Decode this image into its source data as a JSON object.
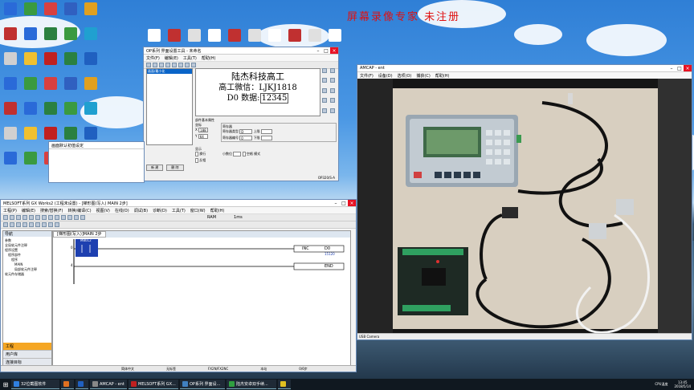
{
  "watermark": "屏幕录像专家 未注册",
  "desktop_icons": [
    {
      "label": "",
      "color": "#2a6ad8"
    },
    {
      "label": "",
      "color": "#3a9a40"
    },
    {
      "label": "",
      "color": "#d84040"
    },
    {
      "label": "",
      "color": "#3060c0"
    },
    {
      "label": "",
      "color": "#e0a020"
    },
    {
      "label": "",
      "color": "#c03030"
    },
    {
      "label": "",
      "color": "#2a6ad8"
    },
    {
      "label": "",
      "color": "#2a8040"
    },
    {
      "label": "",
      "color": "#3a9a40"
    },
    {
      "label": "",
      "color": "#20a0d0"
    },
    {
      "label": "",
      "color": "#d0d0d0"
    },
    {
      "label": "",
      "color": "#f0c030"
    },
    {
      "label": "",
      "color": "#c02020"
    },
    {
      "label": "",
      "color": "#2a8040"
    },
    {
      "label": "",
      "color": "#2060c0"
    }
  ],
  "op_window": {
    "title": "OP系列 界面设置工具 - 未命名",
    "menus": [
      "文件(F)",
      "编辑(E)",
      "工具(T)",
      "帮助(H)"
    ],
    "lcd_lines": [
      "陆杰科技高工",
      "高工微信：LJKJ1818"
    ],
    "lcd_data_label": "D0 数据:",
    "lcd_data_value": "12345",
    "left_list": [
      "画面/最小化"
    ],
    "btn_new": "新 建",
    "btn_delete": "删 除",
    "props_title": "部件基本属性",
    "coord_label": "坐标",
    "x_label": "X",
    "x_value": "188",
    "y_label": "Y",
    "y_value": "64",
    "reg_title": "寄存器",
    "reg_type_label": "寄存器类型",
    "reg_num_label": "寄存器编号",
    "reg_type_value": "D",
    "reg_num_value": "0",
    "upper_label": "上限",
    "lower_label": "下限",
    "display_title": "显示",
    "decimal_label": "小数位",
    "mode_label": "模式",
    "chk_wrap": "换行",
    "chk_reverse": "反相",
    "chk_space": "空格",
    "status_right": "OP320/S-A",
    "float_panel_title": "画面默认初值设定"
  },
  "gx_window": {
    "title": "MELSOFT系列 GX Works2 (工程未设置) - [梯形图(写入) MAIN 2步]",
    "menus": [
      "工程(P)",
      "编辑(E)",
      "搜索/替换(F)",
      "转换/编译(C)",
      "视图(V)",
      "在线(O)",
      "调试(B)",
      "诊断(D)",
      "工具(T)",
      "窗口(W)",
      "帮助(H)"
    ],
    "ram_label": "RAM",
    "time_label": "1ms",
    "nav_title": "导航",
    "tree": [
      "参数",
      "全局软元件注释",
      "程序设置",
      "程序部件",
      "程序",
      "MAIN",
      "局部软元件注释",
      "软元件存储器"
    ],
    "nav_tabs": [
      "工程",
      "用户库",
      "连接目标"
    ],
    "ladder_tab": "[梯形图(写入)]MAIN 2步",
    "contact_label": "M8012",
    "instr": "INC",
    "operand": "D0",
    "operand_value": "15120",
    "end_label": "END",
    "row1_step": "0",
    "row2_step": "4",
    "status": [
      "简体中文",
      "无标签",
      "FX2N/FX2NC",
      "本站",
      "0/6步"
    ]
  },
  "cam_window": {
    "title": "AMCAP - ent",
    "menus": [
      "文件(F)",
      "设备(D)",
      "选项(O)",
      "捕获(C)",
      "帮助(H)"
    ],
    "status": "USB Camera"
  },
  "taskbar": {
    "items": [
      "32位截图软件",
      "",
      "",
      "AMCAP - ent",
      "MELSOFT系列 GX...",
      "OP系列 界面设...",
      "陆杰安卓双手续...",
      ""
    ],
    "time": "13:45",
    "date": "2018/5/14",
    "weather": "CPU温度"
  }
}
